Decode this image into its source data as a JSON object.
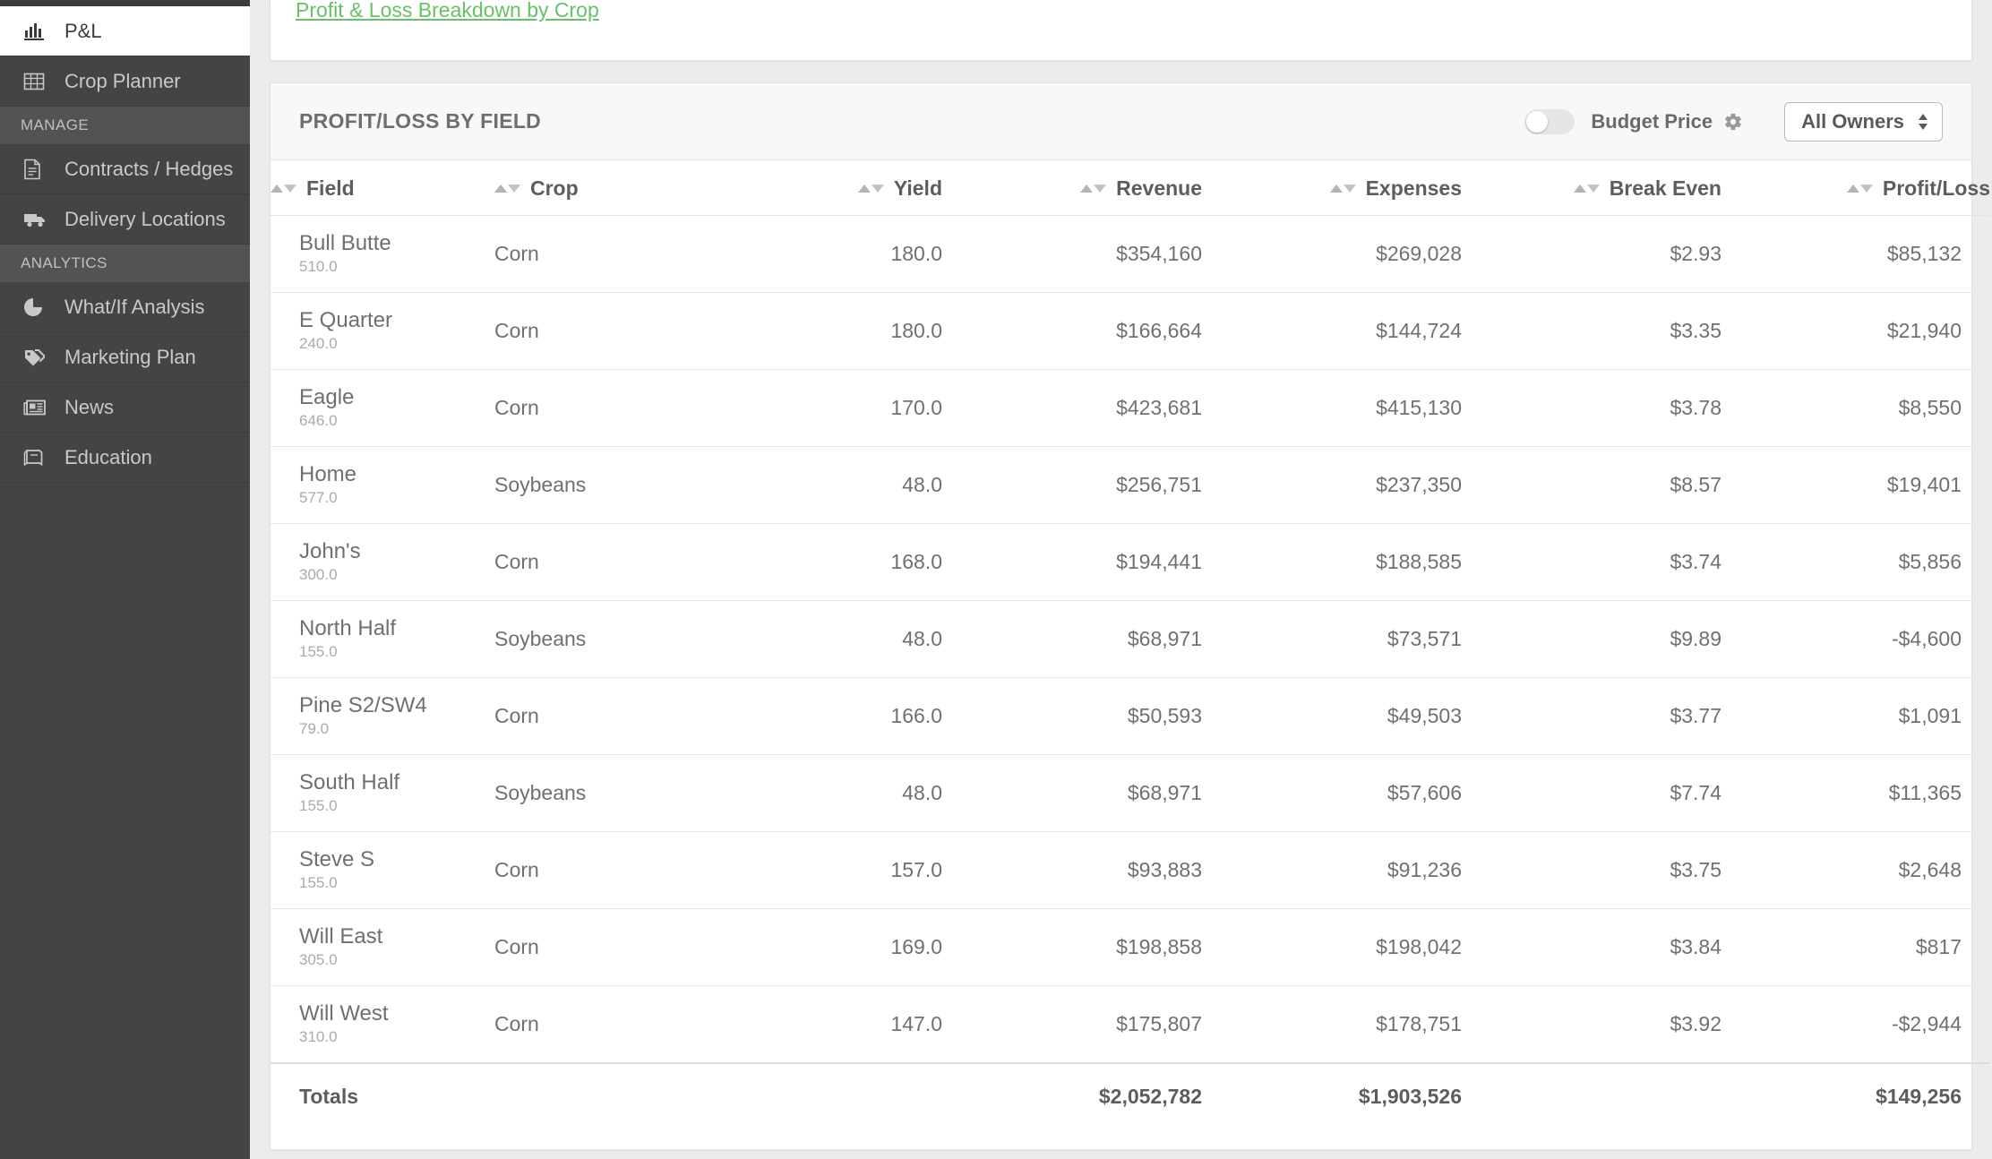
{
  "sidebar": {
    "items": [
      {
        "id": "pl",
        "label": "P&L",
        "icon": "bar-chart-icon",
        "active": true,
        "type": "item"
      },
      {
        "id": "crop-planner",
        "label": "Crop Planner",
        "icon": "table-grid-icon",
        "active": false,
        "type": "item"
      },
      {
        "id": "manage",
        "label": "MANAGE",
        "type": "section"
      },
      {
        "id": "contracts-hedges",
        "label": "Contracts / Hedges",
        "icon": "document-icon",
        "active": false,
        "type": "item"
      },
      {
        "id": "delivery-locations",
        "label": "Delivery Locations",
        "icon": "truck-icon",
        "active": false,
        "type": "item"
      },
      {
        "id": "analytics",
        "label": "ANALYTICS",
        "type": "section"
      },
      {
        "id": "what-if-analysis",
        "label": "What/If Analysis",
        "icon": "pie-chart-icon",
        "active": false,
        "type": "item"
      },
      {
        "id": "marketing-plan",
        "label": "Marketing Plan",
        "icon": "tags-icon",
        "active": false,
        "type": "item"
      },
      {
        "id": "news",
        "label": "News",
        "icon": "newspaper-icon",
        "active": false,
        "type": "item"
      },
      {
        "id": "education",
        "label": "Education",
        "icon": "book-icon",
        "active": false,
        "type": "item"
      }
    ]
  },
  "top_card": {
    "breakdown_link": "Profit & Loss Breakdown by Crop",
    "link_color": "#68c168"
  },
  "panel": {
    "title": "PROFIT/LOSS BY FIELD",
    "budget_price_label": "Budget Price",
    "budget_price_on": false,
    "gear_icon": "gear-icon",
    "owner_select_value": "All Owners"
  },
  "table": {
    "columns": [
      {
        "key": "field",
        "label": "Field",
        "align": "left"
      },
      {
        "key": "crop",
        "label": "Crop",
        "align": "left"
      },
      {
        "key": "yield",
        "label": "Yield",
        "align": "right"
      },
      {
        "key": "revenue",
        "label": "Revenue",
        "align": "right"
      },
      {
        "key": "expenses",
        "label": "Expenses",
        "align": "right"
      },
      {
        "key": "break_even",
        "label": "Break Even",
        "align": "right"
      },
      {
        "key": "profit_loss",
        "label": "Profit/Loss",
        "align": "right"
      }
    ],
    "rows": [
      {
        "field": "Bull Butte",
        "acres": "510.0",
        "crop": "Corn",
        "yield": "180.0",
        "revenue": "$354,160",
        "expenses": "$269,028",
        "break_even": "$2.93",
        "profit_loss": "$85,132"
      },
      {
        "field": "E Quarter",
        "acres": "240.0",
        "crop": "Corn",
        "yield": "180.0",
        "revenue": "$166,664",
        "expenses": "$144,724",
        "break_even": "$3.35",
        "profit_loss": "$21,940"
      },
      {
        "field": "Eagle",
        "acres": "646.0",
        "crop": "Corn",
        "yield": "170.0",
        "revenue": "$423,681",
        "expenses": "$415,130",
        "break_even": "$3.78",
        "profit_loss": "$8,550"
      },
      {
        "field": "Home",
        "acres": "577.0",
        "crop": "Soybeans",
        "yield": "48.0",
        "revenue": "$256,751",
        "expenses": "$237,350",
        "break_even": "$8.57",
        "profit_loss": "$19,401"
      },
      {
        "field": "John's",
        "acres": "300.0",
        "crop": "Corn",
        "yield": "168.0",
        "revenue": "$194,441",
        "expenses": "$188,585",
        "break_even": "$3.74",
        "profit_loss": "$5,856"
      },
      {
        "field": "North Half",
        "acres": "155.0",
        "crop": "Soybeans",
        "yield": "48.0",
        "revenue": "$68,971",
        "expenses": "$73,571",
        "break_even": "$9.89",
        "profit_loss": "-$4,600"
      },
      {
        "field": "Pine S2/SW4",
        "acres": "79.0",
        "crop": "Corn",
        "yield": "166.0",
        "revenue": "$50,593",
        "expenses": "$49,503",
        "break_even": "$3.77",
        "profit_loss": "$1,091"
      },
      {
        "field": "South Half",
        "acres": "155.0",
        "crop": "Soybeans",
        "yield": "48.0",
        "revenue": "$68,971",
        "expenses": "$57,606",
        "break_even": "$7.74",
        "profit_loss": "$11,365"
      },
      {
        "field": "Steve S",
        "acres": "155.0",
        "crop": "Corn",
        "yield": "157.0",
        "revenue": "$93,883",
        "expenses": "$91,236",
        "break_even": "$3.75",
        "profit_loss": "$2,648"
      },
      {
        "field": "Will East",
        "acres": "305.0",
        "crop": "Corn",
        "yield": "169.0",
        "revenue": "$198,858",
        "expenses": "$198,042",
        "break_even": "$3.84",
        "profit_loss": "$817"
      },
      {
        "field": "Will West",
        "acres": "310.0",
        "crop": "Corn",
        "yield": "147.0",
        "revenue": "$175,807",
        "expenses": "$178,751",
        "break_even": "$3.92",
        "profit_loss": "-$2,944"
      }
    ],
    "totals": {
      "label": "Totals",
      "crop": "",
      "yield": "",
      "revenue": "$2,052,782",
      "expenses": "$1,903,526",
      "break_even": "",
      "profit_loss": "$149,256"
    }
  }
}
